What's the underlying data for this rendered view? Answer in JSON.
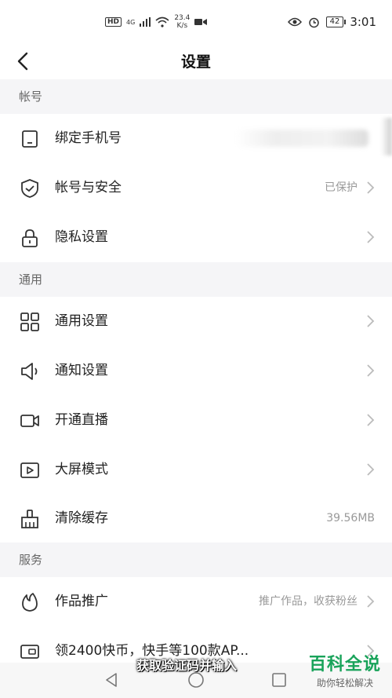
{
  "status_bar": {
    "hd": "HD",
    "net": "4G",
    "speed_value": "23.4",
    "speed_unit": "K/s",
    "battery": "42",
    "time": "3:01"
  },
  "header": {
    "title": "设置"
  },
  "sections": {
    "account": "帐号",
    "general": "通用",
    "service": "服务"
  },
  "rows": {
    "bind_phone": {
      "label": "绑定手机号"
    },
    "account_security": {
      "label": "帐号与安全",
      "value": "已保护"
    },
    "privacy": {
      "label": "隐私设置"
    },
    "general_settings": {
      "label": "通用设置"
    },
    "notification": {
      "label": "通知设置"
    },
    "live": {
      "label": "开通直播"
    },
    "big_screen": {
      "label": "大屏模式"
    },
    "clear_cache": {
      "label": "清除缓存",
      "value": "39.56MB"
    },
    "promotion": {
      "label": "作品推广",
      "value": "推广作品，收获粉丝"
    },
    "coins": {
      "label": "领2400快币，快手等100款AP..."
    }
  },
  "overlay": {
    "caption": "获取验证码并输入",
    "watermark_main": "百科全说",
    "watermark_sub": "助你轻松解决"
  },
  "colors": {
    "accent": "#19a35a",
    "section_bg": "#f5f5f7",
    "muted": "#999999"
  }
}
